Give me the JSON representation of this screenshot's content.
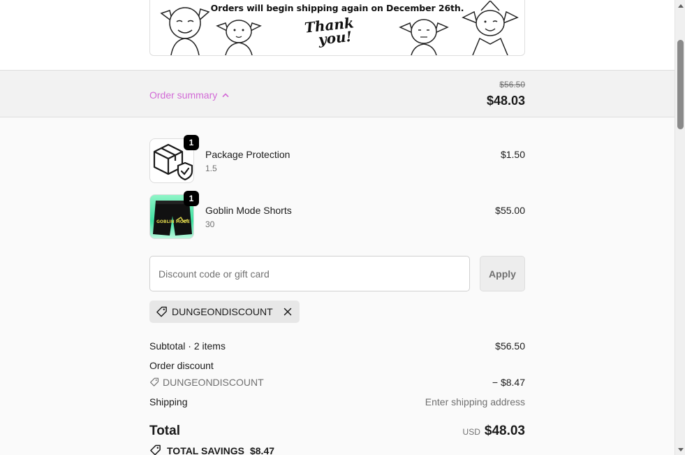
{
  "banner": {
    "notice": "Orders will begin shipping again on December 26th.",
    "thanks_line1": "Thank",
    "thanks_line2": "you!"
  },
  "summary": {
    "toggle_label": "Order summary",
    "original_price": "$56.50",
    "price": "$48.03"
  },
  "items": [
    {
      "name": "Package Protection",
      "variant": "1.5",
      "price": "$1.50",
      "quantity": "1"
    },
    {
      "name": "Goblin Mode Shorts",
      "variant": "30",
      "price": "$55.00",
      "quantity": "1",
      "print_text": "GOBLIN MODE"
    }
  ],
  "discount": {
    "placeholder": "Discount code or gift card",
    "value": "",
    "apply_label": "Apply",
    "applied_code": "DUNGEONDISCOUNT"
  },
  "totals": {
    "subtotal_label": "Subtotal · 2 items",
    "subtotal_value": "$56.50",
    "order_discount_label": "Order discount",
    "discount_code": "DUNGEONDISCOUNT",
    "discount_value": "− $8.47",
    "shipping_label": "Shipping",
    "shipping_value": "Enter shipping address",
    "total_label": "Total",
    "currency": "USD",
    "total_value": "$48.03",
    "savings_label": "TOTAL SAVINGS",
    "savings_value": "$8.47"
  },
  "colors": {
    "accent": "#d26ad6",
    "background": "#fafafa",
    "summary_bar": "#f2f2f2",
    "badge": "#000000",
    "shorts_bg": "#3ee0a0"
  },
  "icons": {
    "chevron": "chevron-up-icon",
    "tag": "tag-icon",
    "remove": "close-icon",
    "package": "package-shield-icon"
  }
}
